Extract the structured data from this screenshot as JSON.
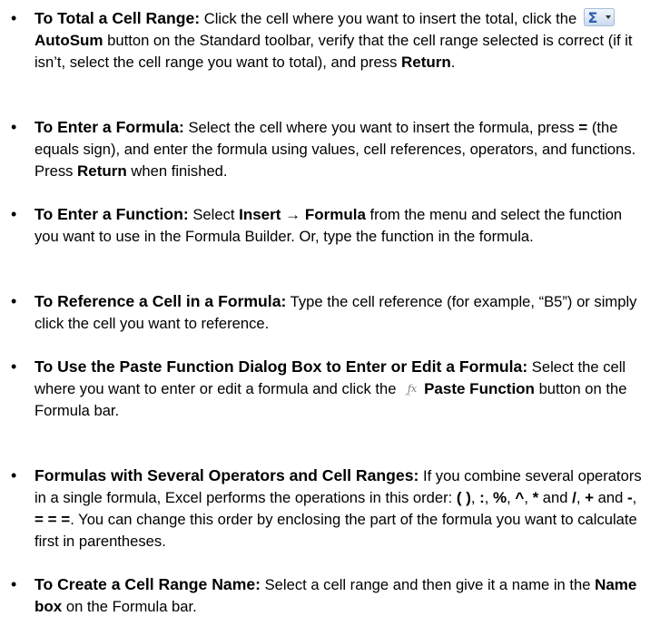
{
  "items": [
    {
      "lead": "To Total a Cell Range:",
      "t1": " Click the cell where you want to insert the total, click the",
      "b1": "AutoSum",
      "t2": " button on the Standard toolbar, verify that the cell range selected is correct (if it isn’t, select the cell range you want to total), and press ",
      "b2": "Return",
      "t3": "."
    },
    {
      "lead": "To Enter a Formula:",
      "t1": " Select the cell where you want to insert the formula, press ",
      "b1": "=",
      "t2": " (the equals sign), and enter the formula using values, cell references, operators, and functions.  Press ",
      "b2": "Return",
      "t3": " when finished."
    },
    {
      "lead": "To Enter a Function:",
      "t1": " Select ",
      "b1": "Insert → Formula",
      "t2": " from the menu and select the function you want to use in the Formula Builder. Or, type the function in the formula."
    },
    {
      "lead": "To Reference a Cell in a Formula:",
      "t1": " Type the cell reference (for example, “B5”) or simply click the cell you want to reference."
    },
    {
      "lead": "To Use the Paste Function Dialog Box to Enter or Edit a Formula:",
      "t1": " Select the cell where you want to enter or edit a formula and click the",
      "b1": "Paste Function",
      "t2": " button on the Formula bar."
    },
    {
      "lead": "Formulas with Several Operators and Cell Ranges:",
      "t1": " If you combine several operators in a single formula, Excel performs the operations in this order: ",
      "b1": "( )",
      "s1": ", ",
      "b2": ":",
      "s2": ", ",
      "b3": "%",
      "s3": ", ",
      "b4": "^",
      "s4": ", ",
      "b5": "*",
      "s5": " and ",
      "b6": "/",
      "s6": ", ",
      "b7": "+",
      "s7": " and ",
      "b8": "-",
      "s8": ", ",
      "b9": "= = =",
      "t2": ". You can change this order by enclosing the part of the formula you want to calculate first in parentheses."
    },
    {
      "lead": "To Create a Cell Range Name:",
      "t1": " Select a cell range and then give it a name in the  ",
      "b1": "Name box",
      "t2": " on the Formula bar."
    }
  ],
  "bullet": "•",
  "icons": {
    "autosum": "autosum-icon",
    "paste_function": "fx-icon"
  }
}
